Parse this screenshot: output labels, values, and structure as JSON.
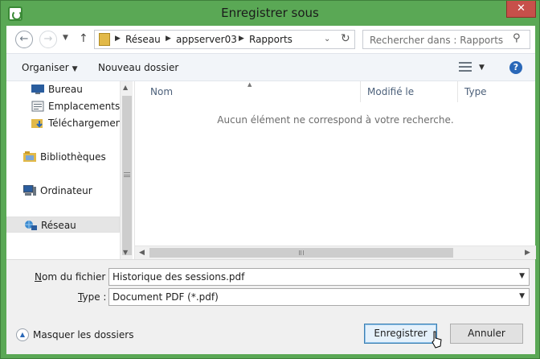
{
  "window": {
    "title": "Enregistrer sous",
    "close_glyph": "✕"
  },
  "address_bar": {
    "crumbs": [
      "Réseau",
      "appserver03",
      "Rapports"
    ],
    "search_placeholder": "Rechercher dans : Rapports"
  },
  "toolbar": {
    "organize": "Organiser",
    "new_folder": "Nouveau dossier",
    "help_glyph": "?"
  },
  "nav_pane": {
    "items": [
      {
        "label": "Bureau",
        "icon": "desktop-icon"
      },
      {
        "label": "Emplacements récents",
        "icon": "recent-places-icon"
      },
      {
        "label": "Téléchargements",
        "icon": "downloads-icon"
      },
      {
        "label": "Bibliothèques",
        "icon": "libraries-icon"
      },
      {
        "label": "Ordinateur",
        "icon": "computer-icon"
      },
      {
        "label": "Réseau",
        "icon": "network-icon",
        "selected": true
      }
    ]
  },
  "file_list": {
    "columns": [
      "Nom",
      "Modifié le",
      "Type"
    ],
    "empty_message": "Aucun élément ne correspond à votre recherche."
  },
  "save_form": {
    "filename_label_accel": "N",
    "filename_label_rest": "om du fichier :",
    "filename_value": "Historique des sessions.pdf",
    "type_label_accel": "T",
    "type_label_rest": "ype :",
    "type_value": "Document PDF (*.pdf)"
  },
  "footer": {
    "hide_folders": "Masquer les dossiers",
    "save_button": "Enregistrer",
    "cancel_button": "Annuler"
  },
  "colors": {
    "window_frame": "#5aa855",
    "close_button": "#c7504a",
    "primary_button_border": "#3c7fb1",
    "selected_nav": "#e5e5e5"
  }
}
